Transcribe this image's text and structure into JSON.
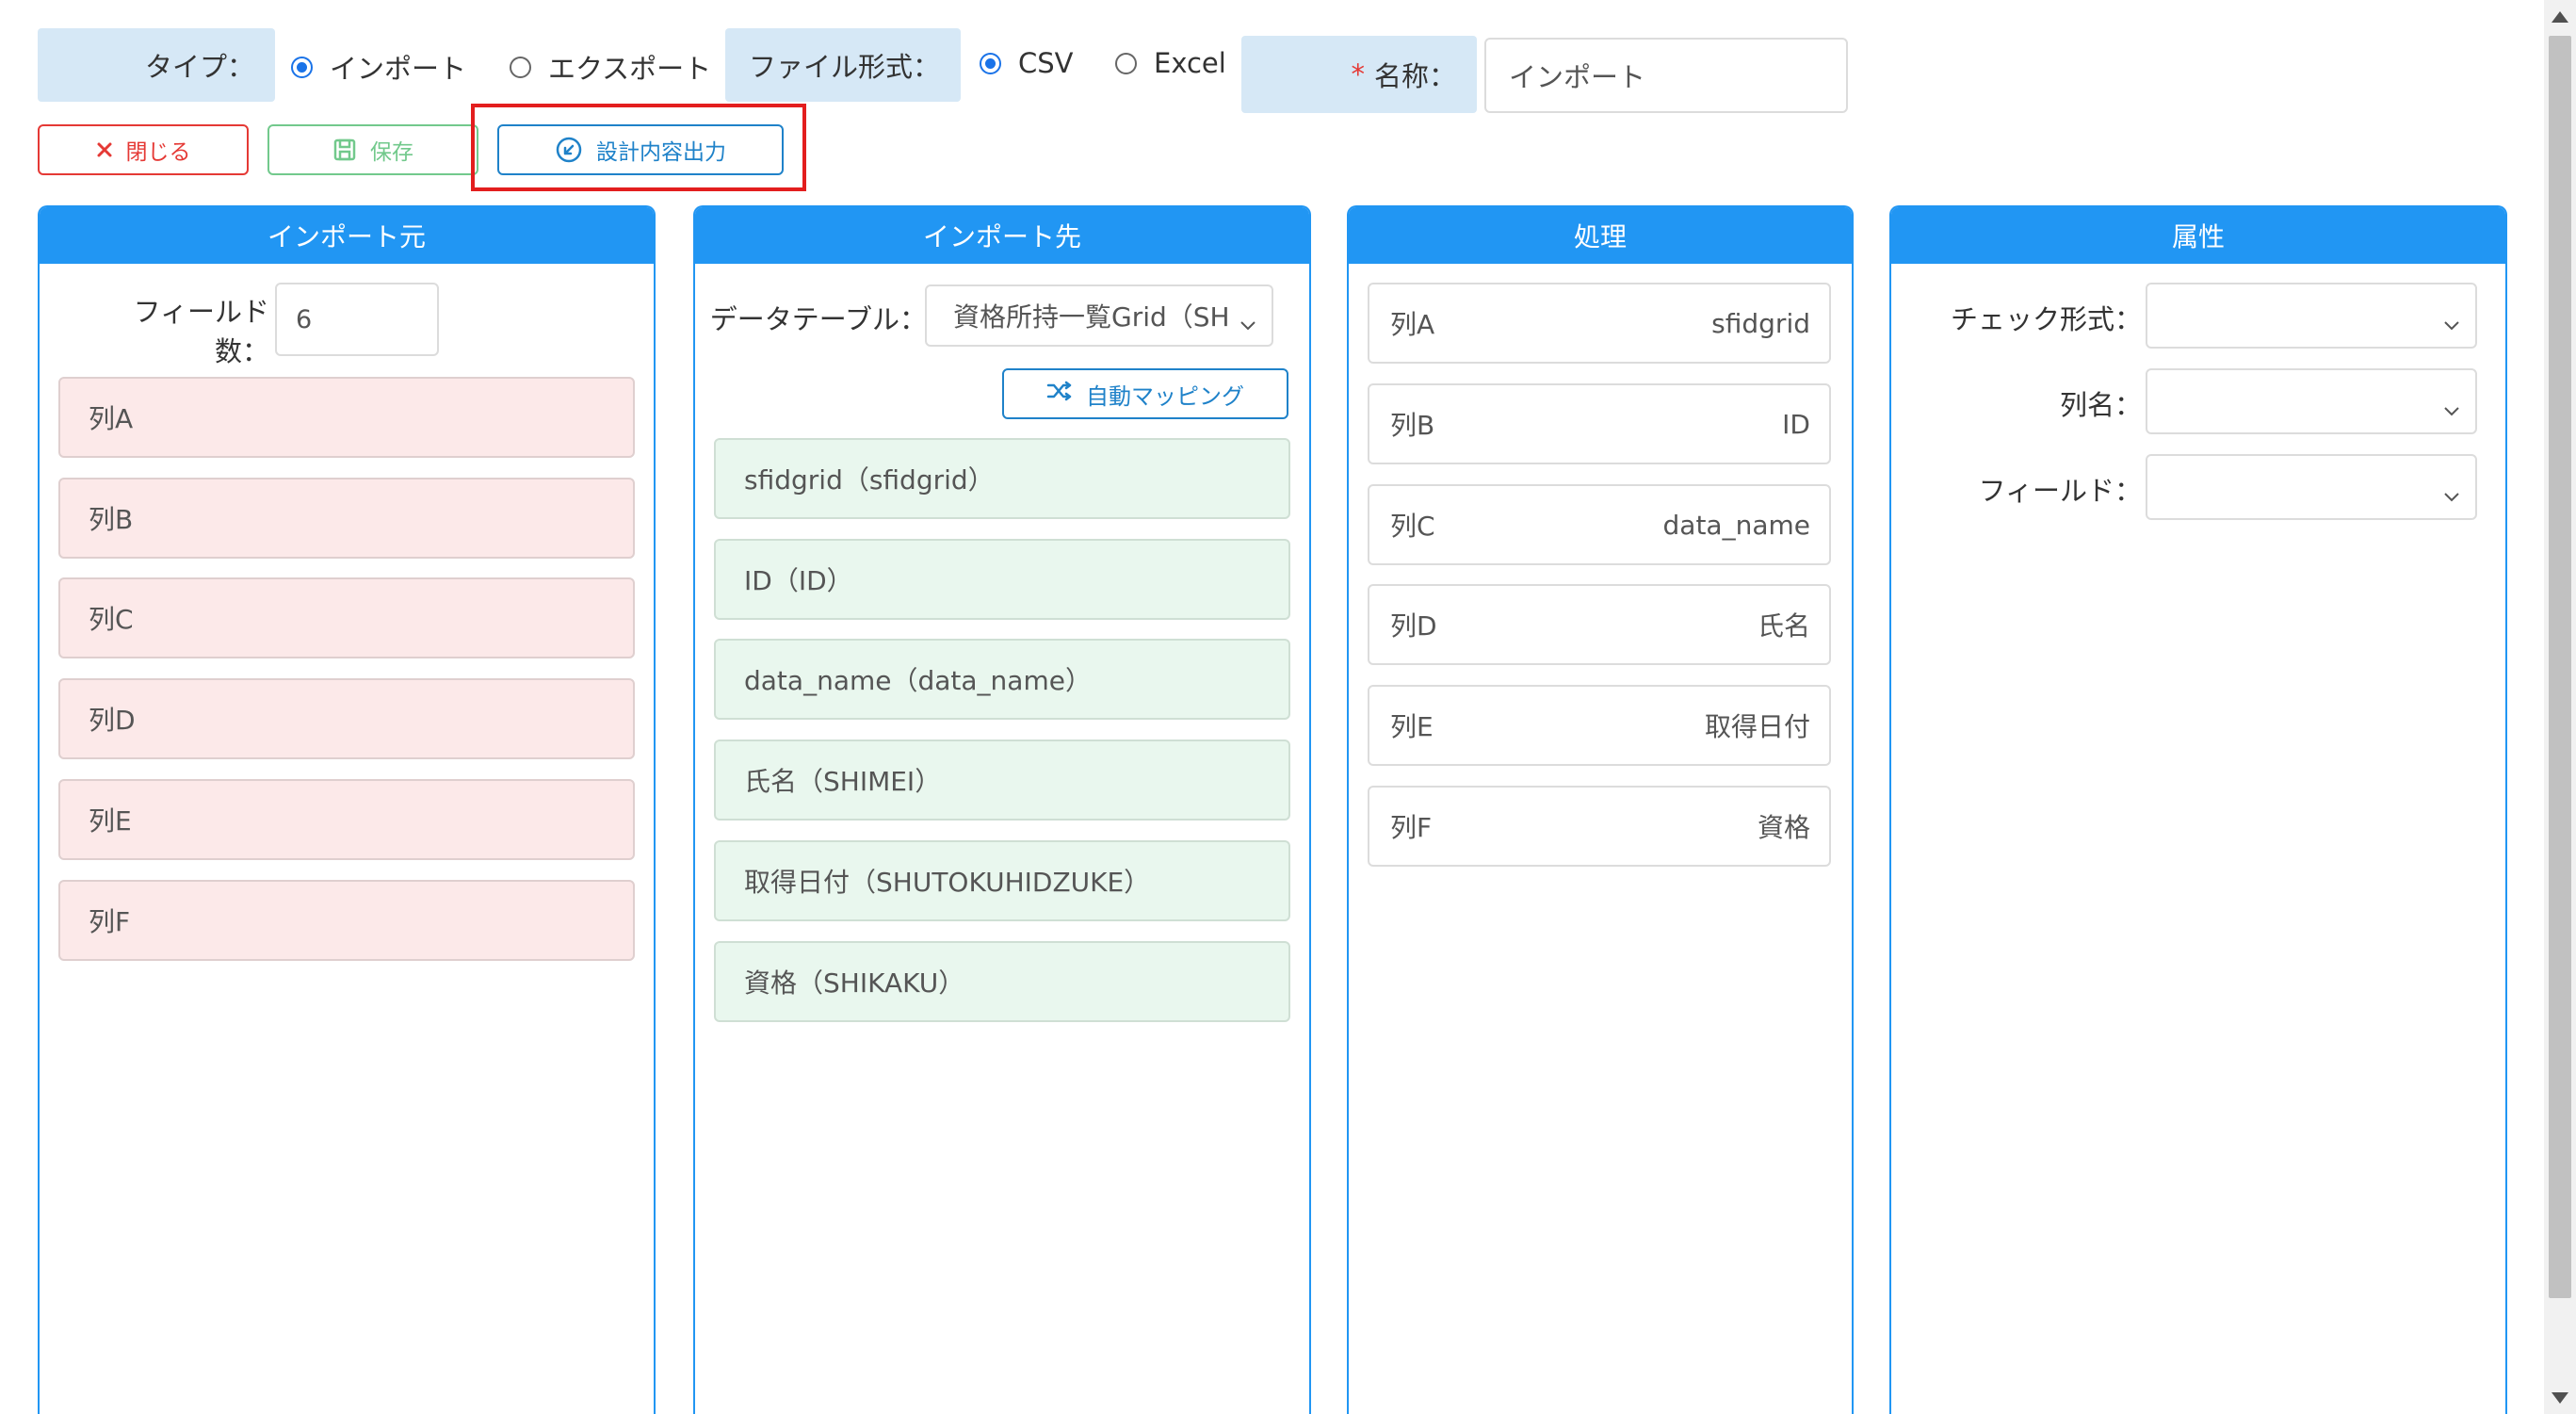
{
  "form": {
    "type_label": "タイプ：",
    "type_options": [
      "インポート",
      "エクスポート"
    ],
    "type_selected": "インポート",
    "format_label": "ファイル形式：",
    "format_options": [
      "CSV",
      "Excel"
    ],
    "format_selected": "CSV",
    "name_required_mark": "*",
    "name_label": "名称：",
    "name_value": "インポート"
  },
  "toolbar": {
    "close_label": "閉じる",
    "save_label": "保存",
    "export_label": "設計内容出力"
  },
  "source_panel": {
    "title": "インポート元",
    "field_count_label": "フィールド数：",
    "field_count_value": "6",
    "items": [
      "列A",
      "列B",
      "列C",
      "列D",
      "列E",
      "列F"
    ]
  },
  "target_panel": {
    "title": "インポート先",
    "table_label": "データテーブル：",
    "table_value": "資格所持一覧Grid（SH",
    "auto_mapping_label": "自動マッピング",
    "items": [
      "sfidgrid（sfidgrid）",
      "ID（ID）",
      "data_name（data_name）",
      "氏名（SHIMEI）",
      "取得日付（SHUTOKUHIDZUKE）",
      "資格（SHIKAKU）"
    ]
  },
  "process_panel": {
    "title": "処理",
    "rows": [
      {
        "col": "列A",
        "field": "sfidgrid"
      },
      {
        "col": "列B",
        "field": "ID"
      },
      {
        "col": "列C",
        "field": "data_name"
      },
      {
        "col": "列D",
        "field": "氏名"
      },
      {
        "col": "列E",
        "field": "取得日付"
      },
      {
        "col": "列F",
        "field": "資格"
      }
    ]
  },
  "attr_panel": {
    "title": "属性",
    "check_format_label": "チェック形式：",
    "col_name_label": "列名：",
    "field_label": "フィールド：",
    "check_format_value": "",
    "col_name_value": "",
    "field_value": ""
  },
  "colors": {
    "accent": "#2196f3",
    "label_bg": "#d6e8f6",
    "close": "#e53935",
    "save": "#72c98c",
    "export": "#1f82c9",
    "highlight": "#e31e1e",
    "source_item_bg": "#fce9e9",
    "target_item_bg": "#e9f7ee"
  }
}
